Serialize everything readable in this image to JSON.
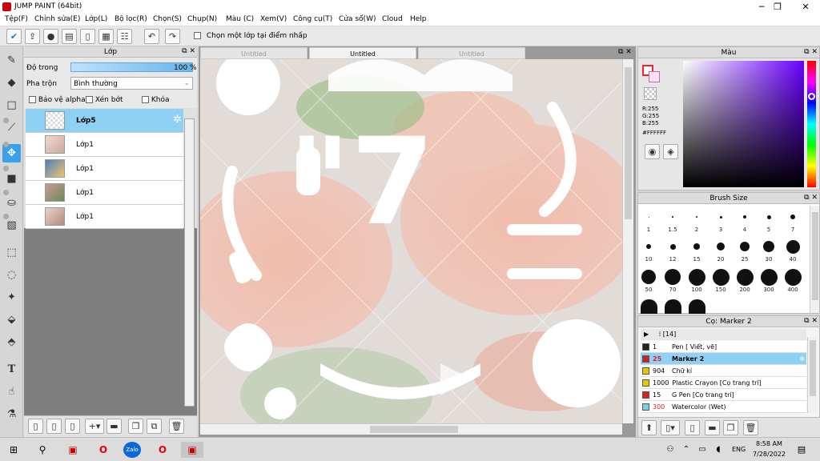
{
  "window": {
    "title": "JUMP PAINT (64bit)",
    "minimize": "─",
    "maximize": "❐",
    "close": "✕"
  },
  "menu": [
    "Tệp(F)",
    "Chỉnh sửa(E)",
    "Lớp(L)",
    "Bộ lọc(R)",
    "Chọn(S)",
    "Chụp(N)",
    "Màu (C)",
    "Xem(V)",
    "Công cụ(T)",
    "Cửa sổ(W)",
    "Cloud",
    "Help"
  ],
  "toolbar": {
    "select_layer_label": "Chọn một lớp tại điểm nhấp"
  },
  "layers_panel": {
    "title": "Lớp",
    "opacity_label": "Độ trong",
    "opacity_value": "100 %",
    "opacity_fraction": 1.0,
    "blend_label": "Pha trộn",
    "blend_value": "Bình thường",
    "protect_alpha": "Bảo vệ alpha",
    "clip": "Xén bớt",
    "lock": "Khóa",
    "layers": [
      "Lớp5",
      "Lớp1",
      "Lớp1",
      "Lớp1",
      "Lớp1"
    ],
    "selected_index": 0
  },
  "tabs": [
    "Untitled",
    "Untitled",
    "Untitled"
  ],
  "active_tab": 1,
  "canvas": {
    "big_text": "\"7"
  },
  "color_panel": {
    "title": "Màu",
    "r": "R:255",
    "g": "G:255",
    "b": "B:255",
    "hex": "#FFFFFF",
    "fg_color": "#ffffff"
  },
  "brush_size": {
    "title": "Brush Size",
    "sizes": [
      "1",
      "1.5",
      "2",
      "3",
      "4",
      "5",
      "7",
      "10",
      "12",
      "15",
      "20",
      "25",
      "30",
      "40",
      "50",
      "70",
      "100",
      "150",
      "200",
      "300",
      "400"
    ]
  },
  "brush_panel": {
    "title": "Cọ: Marker 2",
    "group_label": "[14]",
    "items": [
      {
        "size": "1",
        "name": "Pen [ Viết, vẽ]",
        "color": "#222222"
      },
      {
        "size": "25",
        "name": "Marker 2",
        "color": "#cc2222"
      },
      {
        "size": "904",
        "name": "Chữ kí",
        "color": "#e6c800"
      },
      {
        "size": "1000",
        "name": "Plastic Crayon [Cọ trang trí]",
        "color": "#e6c800"
      },
      {
        "size": "15",
        "name": "G Pen [Cọ trang trí]",
        "color": "#e02020"
      },
      {
        "size": "300",
        "name": "Watercolor (Wet)",
        "color": "#7cd0ee"
      }
    ],
    "selected_index": 1
  },
  "taskbar": {
    "lang": "ENG",
    "time": "8:58 AM",
    "date": "7/28/2022",
    "zalo": "Zalo"
  }
}
